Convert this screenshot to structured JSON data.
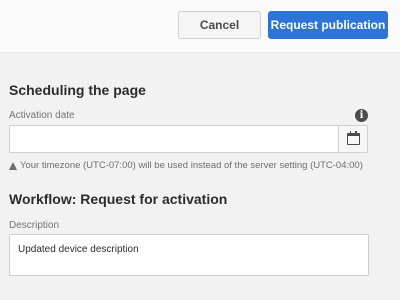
{
  "toolbar": {
    "cancel_label": "Cancel",
    "request_label": "Request publication"
  },
  "scheduling": {
    "title": "Scheduling the page",
    "activation_label": "Activation date",
    "activation_value": "",
    "timezone_note": "Your timezone (UTC-07:00) will be used instead of the server setting (UTC-04:00)"
  },
  "workflow": {
    "title": "Workflow: Request for activation",
    "description_label": "Description",
    "description_value": "Updated device description"
  },
  "icons": {
    "info": "info-icon",
    "calendar": "calendar-icon",
    "warning": "warning-icon"
  },
  "colors": {
    "primary": "#2d74d8",
    "background": "#f2f2f2"
  }
}
